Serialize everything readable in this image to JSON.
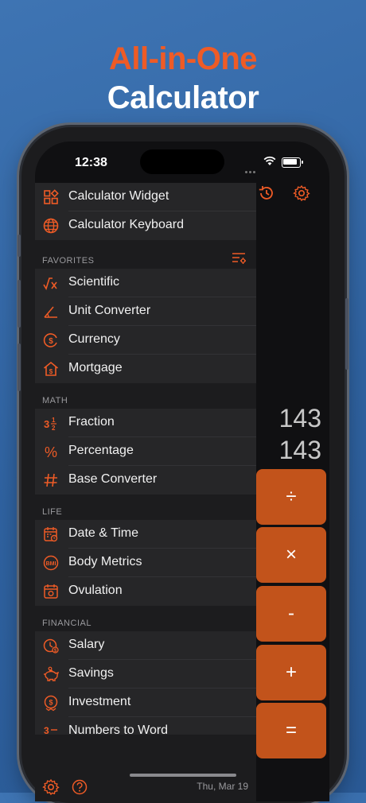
{
  "headline": {
    "line1": "All-in-One",
    "line2": "Calculator"
  },
  "status": {
    "time": "12:38"
  },
  "calc": {
    "display_top": "143",
    "display_main": "143",
    "ops": [
      "÷",
      "×",
      "-",
      "+",
      "="
    ]
  },
  "top_items": [
    {
      "label": "Calculator Widget",
      "icon": "widget-grid-icon"
    },
    {
      "label": "Calculator Keyboard",
      "icon": "globe-icon"
    }
  ],
  "favorites": {
    "header": "FAVORITES",
    "items": [
      {
        "label": "Scientific",
        "icon": "sqrt-function-icon"
      },
      {
        "label": "Unit Converter",
        "icon": "angle-ruler-icon"
      },
      {
        "label": "Currency",
        "icon": "dollar-circle-icon"
      },
      {
        "label": "Mortgage",
        "icon": "house-dollar-icon"
      }
    ]
  },
  "math": {
    "header": "MATH",
    "items": [
      {
        "label": "Fraction",
        "icon": "fraction-icon"
      },
      {
        "label": "Percentage",
        "icon": "percent-icon"
      },
      {
        "label": "Base Converter",
        "icon": "hash-icon"
      }
    ]
  },
  "life": {
    "header": "LIFE",
    "items": [
      {
        "label": "Date & Time",
        "icon": "calendar-clock-icon"
      },
      {
        "label": "Body Metrics",
        "icon": "bmi-icon"
      },
      {
        "label": "Ovulation",
        "icon": "calendar-heart-icon"
      }
    ]
  },
  "financial": {
    "header": "FINANCIAL",
    "items": [
      {
        "label": "Salary",
        "icon": "salary-clock-icon"
      },
      {
        "label": "Savings",
        "icon": "piggy-bank-icon"
      },
      {
        "label": "Investment",
        "icon": "investment-icon"
      },
      {
        "label": "Numbers to Word",
        "icon": "numbers-word-icon"
      }
    ]
  },
  "footer": {
    "date": "Thu, Mar 19"
  },
  "colors": {
    "accent": "#ee5b26",
    "button": "#c2531b",
    "background": "#2f62a0"
  }
}
